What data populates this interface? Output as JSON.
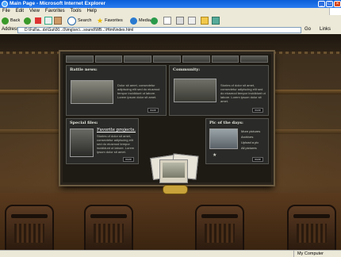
{
  "window": {
    "title": "Main Page - Microsoft Internet Explorer",
    "controls": [
      "_",
      "□",
      "×"
    ]
  },
  "menu": [
    "File",
    "Edit",
    "View",
    "Favorites",
    "Tools",
    "Help"
  ],
  "toolbar": {
    "back": "Back",
    "search": "Search",
    "favorites": "Favorites",
    "media": "Media"
  },
  "address": {
    "label": "Address",
    "value": "D:\\Full\\a...dx\\Gui\\00...0\\img\\src\\...sound\\WB...\\Html\\index.html",
    "go": "Go",
    "links": "Links"
  },
  "panels": {
    "battle": {
      "title": "Battle news:",
      "text": "Dolor sit amet, consectetur adipiscing elit sed do eiusmod tempor incididunt ut labore. Lorem ipsum dolor sit amet.",
      "more": "more"
    },
    "community": {
      "title": "Community:",
      "text": "Stories of dolor sit amet, consectetur adipiscing elit sed do eiusmod tempor incididunt ut labore. Lorem ipsum dolor sit amet.",
      "more": "more"
    },
    "special": {
      "title": "Special files:",
      "link_title": "Favorite projects.",
      "text": "Stories of dolor sit amet, consectetur adipiscing elit sed do eiusmod tempor incididunt ut labore. Lorem ipsum dolor sit amet.",
      "more": "more"
    },
    "pic_of_day": {
      "title": "Pic of the days:",
      "links": [
        "More pictures",
        "Archives",
        "Upload a pic",
        "All pictures"
      ],
      "more": "more"
    }
  },
  "status": {
    "left": "",
    "zone": "My Computer"
  }
}
